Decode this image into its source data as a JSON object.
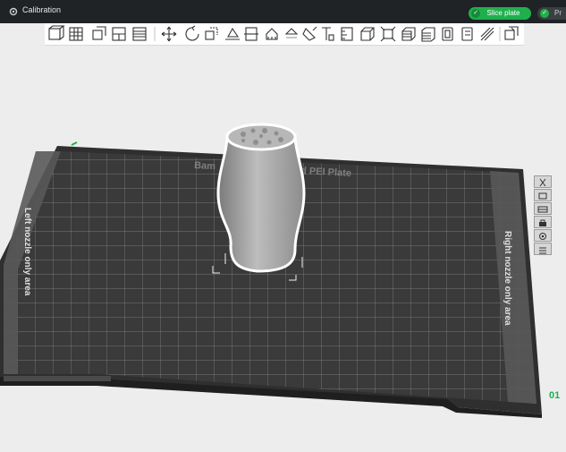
{
  "window": {
    "tab_title": "Calibration",
    "slice_button": "Slice plate",
    "print_button": "Pr"
  },
  "toolbar": {
    "tools": [
      "add-object-icon",
      "grid-plate-icon",
      "orient-icon",
      "arrange-icon",
      "layer-icon",
      "move-icon",
      "rotate-icon",
      "scale-icon",
      "lay-on-face-icon",
      "cut-icon",
      "support-paint-icon",
      "seam-paint-icon",
      "color-paint-icon",
      "text-icon",
      "measure-icon",
      "assembly-icon",
      "auto-fit-icon",
      "variable-layer-icon",
      "slice-preview-icon",
      "split-objects-icon",
      "split-parts-icon",
      "brim-ears-icon",
      "view-options-icon"
    ]
  },
  "plate": {
    "name_left": "Bam",
    "name_right": "d PEI Plate",
    "left_area_label": "Left nozzle only area",
    "right_area_label": "Right nozzle only area",
    "corner_label": "01"
  },
  "plate_tools": [
    "close-plate-icon",
    "edit-plate-icon",
    "plate-settings-icon",
    "lock-plate-icon",
    "visibility-icon",
    "more-icon"
  ],
  "colors": {
    "accent_green": "#1fb04d",
    "titlebar": "#1f2326",
    "plate_dark": "#3a3a3a"
  }
}
